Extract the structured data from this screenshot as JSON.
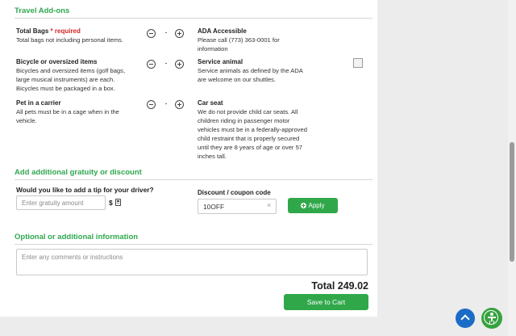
{
  "sections": {
    "travel_addons": "Travel Add-ons",
    "gratuity": "Add additional gratuity or discount",
    "optional": "Optional or additional information"
  },
  "addons": {
    "bags": {
      "title": "Total Bags",
      "required": "* required",
      "desc": "Total bags not including personal items.",
      "qty": "-"
    },
    "bicycle": {
      "title": "Bicycle or oversized items",
      "desc": "Bicycles and oversized items (golf bags, large musical instruments) are each. Bicycles must be packaged in a box.",
      "qty": "-"
    },
    "pet": {
      "title": "Pet in a carrier",
      "desc": "All pets must be in a cage when in the vehicle.",
      "qty": "-"
    },
    "ada": {
      "title": "ADA Accessible",
      "desc": "Please call (773) 363-0001 for information"
    },
    "service_animal": {
      "title": "Service animal",
      "desc": "Service animals as defined by the ADA are welcome on our shuttles."
    },
    "car_seat": {
      "title": "Car seat",
      "desc": "We do not provide child car seats. All children riding in passenger motor vehicles must be in a federally-approved child restraint that is properly secured until they are 8 years of age or over 57 inches tall."
    }
  },
  "gratuity": {
    "question": "Would you like to add a tip for your driver?",
    "placeholder": "Enter gratuity amount",
    "currency": "$"
  },
  "discount": {
    "label": "Discount / coupon code",
    "value": "10OFF",
    "clear": "×",
    "apply_label": "Apply"
  },
  "comments": {
    "placeholder": "Enter any comments or instructions"
  },
  "summary": {
    "total": "Total 249.02",
    "cart_label": "Save to Cart"
  },
  "colors": {
    "accent_green": "#30a84a",
    "required_red": "#d32626",
    "scroll_top_blue": "#1a6cc6"
  }
}
